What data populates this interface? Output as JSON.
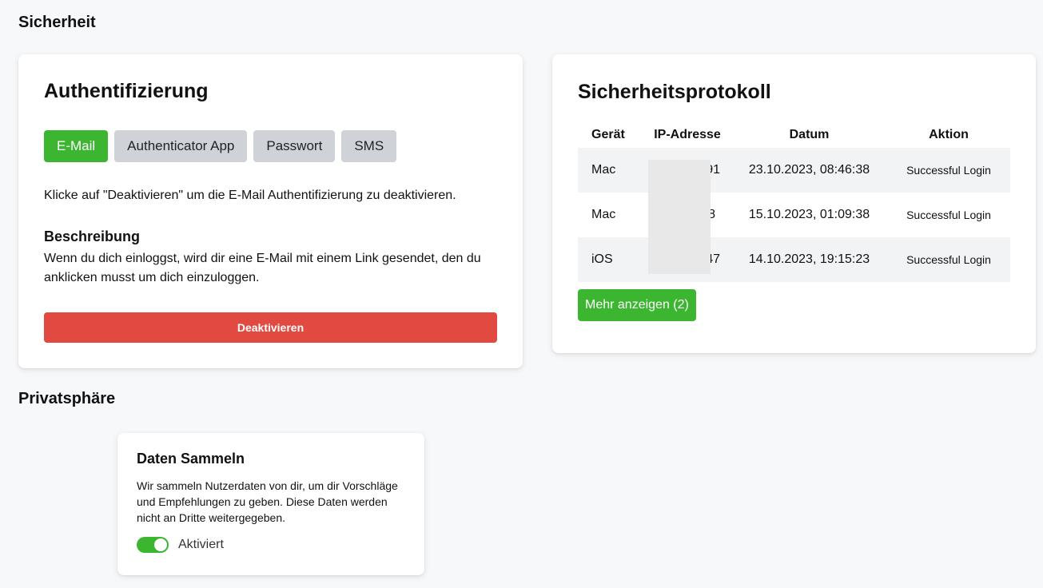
{
  "sections": {
    "security_title": "Sicherheit",
    "privacy_title": "Privatsphäre"
  },
  "auth": {
    "title": "Authentifizierung",
    "tabs": [
      {
        "label": "E-Mail",
        "active": true
      },
      {
        "label": "Authenticator App",
        "active": false
      },
      {
        "label": "Passwort",
        "active": false
      },
      {
        "label": "SMS",
        "active": false
      }
    ],
    "info_text": "Klicke auf \"Deaktivieren\" um die E-Mail Authentifizierung zu deaktivieren.",
    "desc_heading": "Beschreibung",
    "desc_text": "Wenn du dich einloggst, wird dir eine E-Mail mit einem Link gesendet, den du anklicken musst um dich einzuloggen.",
    "deactivate_label": "Deaktivieren"
  },
  "log": {
    "title": "Sicherheitsprotokoll",
    "headers": [
      "Gerät",
      "IP-Adresse",
      "Datum",
      "Aktion"
    ],
    "rows": [
      {
        "device": "Mac",
        "ip": ".91",
        "date": "23.10.2023, 08:46:38",
        "action": "Successful Login"
      },
      {
        "device": "Mac",
        "ip": "38",
        "date": "15.10.2023, 01:09:38",
        "action": "Successful Login"
      },
      {
        "device": "iOS",
        "ip": "47",
        "date": "14.10.2023, 19:15:23",
        "action": "Successful Login"
      }
    ],
    "more_label": "Mehr anzeigen (2)"
  },
  "privacy": {
    "title": "Daten Sammeln",
    "text": "Wir sammeln Nutzerdaten von dir, um dir Vorschläge und Empfehlungen zu geben. Diese Daten werden nicht an Dritte weitergegeben.",
    "toggle_on": true,
    "toggle_label": "Aktiviert"
  },
  "colors": {
    "accent_green": "#3cb531",
    "danger_red": "#e04a41",
    "tab_inactive": "#cfd2d7"
  }
}
